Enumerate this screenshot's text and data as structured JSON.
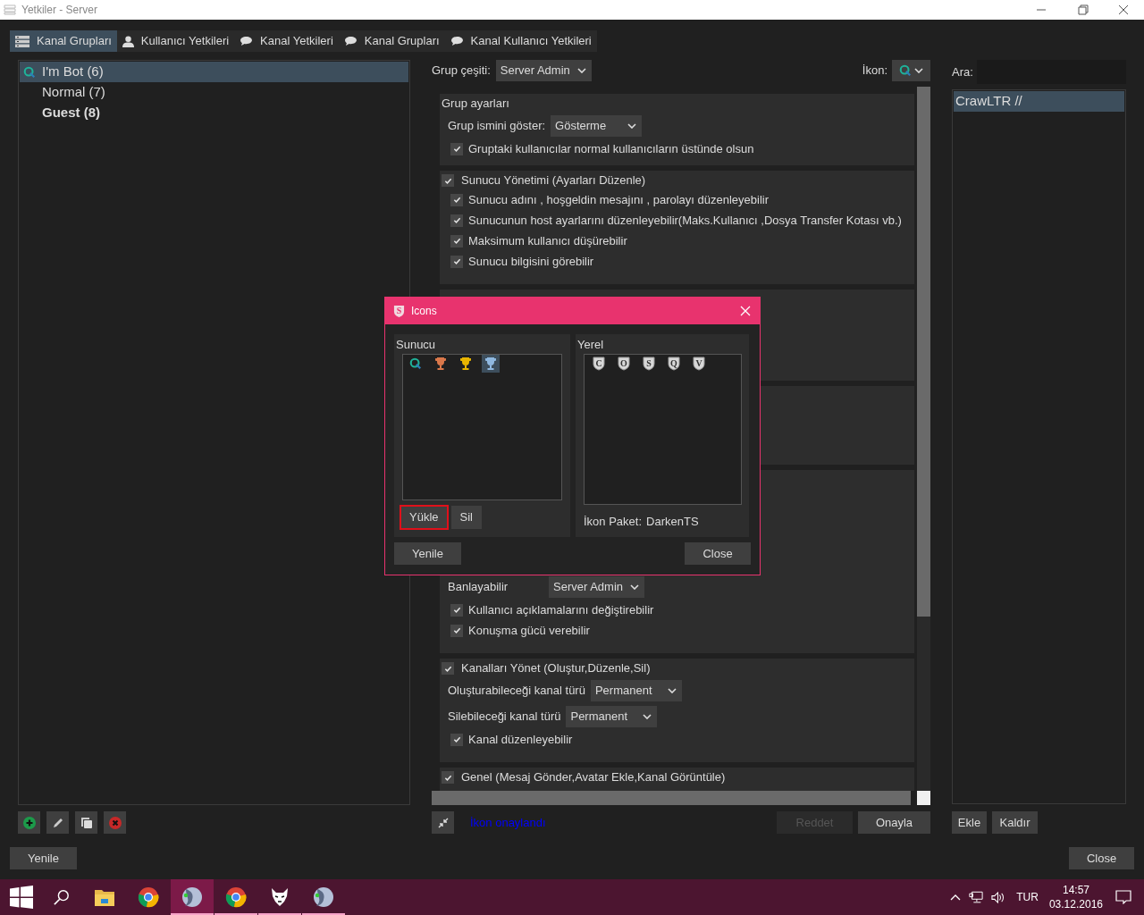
{
  "window": {
    "title": "Yetkiler - Server"
  },
  "tabs": [
    {
      "label": "Kanal Grupları",
      "kind": "server",
      "selected": true
    },
    {
      "label": "Kullanıcı Yetkileri",
      "kind": "user",
      "selected": false
    },
    {
      "label": "Kanal Yetkileri",
      "kind": "chat",
      "selected": false
    },
    {
      "label": "Kanal Grupları",
      "kind": "chat",
      "selected": false
    },
    {
      "label": "Kanal Kullanıcı Yetkileri",
      "kind": "chat",
      "selected": false
    }
  ],
  "groups": [
    {
      "label": "I'm Bot (6)",
      "kind": "iconed",
      "bold": false,
      "selected": true
    },
    {
      "label": "Normal (7)",
      "kind": "plain",
      "bold": false,
      "selected": false
    },
    {
      "label": "Guest (8)",
      "kind": "plain",
      "bold": true,
      "selected": false
    }
  ],
  "refresh_button": "Yenile",
  "group_type": {
    "label": "Grup çeşiti:",
    "value": "Server Admin"
  },
  "icon_picker": {
    "label": "İkon:"
  },
  "sections": [
    {
      "title": "Grup ayarları",
      "items": [
        {
          "kind": "dropdown",
          "label": "Grup ismini göster:",
          "value": "Gösterme"
        },
        {
          "kind": "checkbox",
          "label": "Gruptaki kullanıcılar normal kullanıcıların üstünde olsun",
          "checked": true
        }
      ]
    },
    {
      "title": "Sunucu Yönetimi (Ayarları Düzenle)",
      "checked": true,
      "items": [
        {
          "kind": "checkbox",
          "label": "Sunucu adını , hoşgeldin mesajını , parolayı düzenleyebilir",
          "checked": true
        },
        {
          "kind": "checkbox",
          "label": "Sunucunun host ayarlarını düzenleyebilir(Maks.Kullanıcı ,Dosya Transfer Kotası vb.)",
          "checked": true
        },
        {
          "kind": "checkbox",
          "label": "Maksimum kullanıcı düşürebilir",
          "checked": true
        },
        {
          "kind": "checkbox",
          "label": "Sunucu bilgisini görebilir",
          "checked": true
        }
      ]
    },
    {
      "items": [
        {
          "kind": "dropdown",
          "label": "Banlayabilir",
          "value": "Server Admin"
        },
        {
          "kind": "checkbox",
          "label": "Kullanıcı açıklamalarını değiştirebilir",
          "checked": true
        },
        {
          "kind": "checkbox",
          "label": "Konuşma gücü verebilir",
          "checked": true
        }
      ]
    },
    {
      "title": "Kanalları Yönet (Oluştur,Düzenle,Sil)",
      "checked": true,
      "items": [
        {
          "kind": "dropdown",
          "label": "Oluşturabileceği kanal türü",
          "value": "Permanent"
        },
        {
          "kind": "dropdown",
          "label": "Silebileceği kanal türü",
          "value": "Permanent"
        },
        {
          "kind": "checkbox",
          "label": "Kanal düzenleyebilir",
          "checked": true
        }
      ]
    },
    {
      "title": "Genel (Mesaj Gönder,Avatar Ekle,Kanal Görüntüle)",
      "checked": true
    }
  ],
  "status": {
    "text": "İkon onaylandı"
  },
  "reject_button": {
    "label": "Reddet",
    "disabled": true
  },
  "apply_button": {
    "label": "Onayla",
    "disabled": false
  },
  "search": {
    "label": "Ara:"
  },
  "members": [
    {
      "label": "CrawLTR //",
      "selected": true
    }
  ],
  "add_button": "Ekle",
  "remove_button": "Kaldır",
  "close_button": "Close",
  "icons_dialog": {
    "title": "Icons",
    "title_icon_letter": "S",
    "server": {
      "label": "Sunucu",
      "icons": [
        {
          "kind": "q",
          "selected": false
        },
        {
          "kind": "trophy",
          "color": "#d9774a",
          "selected": false
        },
        {
          "kind": "trophy",
          "color": "#e8b400",
          "selected": false
        },
        {
          "kind": "trophy",
          "color": "#8fb8e0",
          "selected": true
        }
      ],
      "upload_button": {
        "label": "Yükle",
        "highlighted": true
      },
      "delete_button": {
        "label": "Sil",
        "highlighted": false
      }
    },
    "local": {
      "label": "Yerel",
      "icons": [
        {
          "letter": "C"
        },
        {
          "letter": "O"
        },
        {
          "letter": "S"
        },
        {
          "letter": "Q"
        },
        {
          "letter": "V"
        }
      ],
      "pack_label": "İkon Paket:",
      "pack_name": "DarkenTS"
    },
    "refresh_button": "Yenile",
    "close_button": "Close"
  },
  "taskbar": {
    "apps": [
      {
        "kind": "explorer",
        "selected": false,
        "running": false
      },
      {
        "kind": "chrome",
        "selected": false,
        "running": false
      },
      {
        "kind": "speak",
        "selected": true,
        "running": true
      },
      {
        "kind": "chrome",
        "selected": false,
        "running": true
      },
      {
        "kind": "wolf",
        "selected": false,
        "running": true
      },
      {
        "kind": "speak",
        "selected": false,
        "running": true
      }
    ],
    "language": "TUR",
    "time": "14:57",
    "date": "03.12.2016"
  }
}
